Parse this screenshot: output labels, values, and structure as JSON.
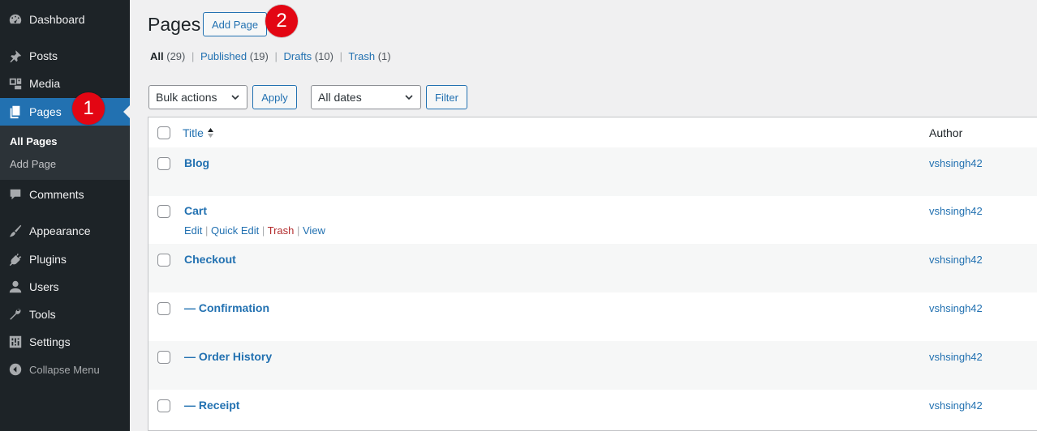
{
  "sidebar": {
    "items": [
      {
        "label": "Dashboard",
        "icon": "dashboard-icon"
      },
      {
        "label": "Posts",
        "icon": "pin-icon"
      },
      {
        "label": "Media",
        "icon": "media-icon"
      },
      {
        "label": "Pages",
        "icon": "pages-icon"
      },
      {
        "label": "Comments",
        "icon": "comment-icon"
      },
      {
        "label": "Appearance",
        "icon": "brush-icon"
      },
      {
        "label": "Plugins",
        "icon": "plugin-icon"
      },
      {
        "label": "Users",
        "icon": "user-icon"
      },
      {
        "label": "Tools",
        "icon": "wrench-icon"
      },
      {
        "label": "Settings",
        "icon": "settings-icon"
      },
      {
        "label": "Collapse Menu",
        "icon": "collapse-icon"
      }
    ],
    "submenu": [
      "All Pages",
      "Add Page"
    ]
  },
  "annotations": {
    "badge1": "1",
    "badge2": "2"
  },
  "header": {
    "title": "Pages",
    "add_button": "Add Page"
  },
  "filters": {
    "all": {
      "label": "All",
      "count": "(29)"
    },
    "published": {
      "label": "Published",
      "count": "(19)"
    },
    "drafts": {
      "label": "Drafts",
      "count": "(10)"
    },
    "trash": {
      "label": "Trash",
      "count": "(1)"
    }
  },
  "toolbar": {
    "bulk_actions": "Bulk actions",
    "apply": "Apply",
    "dates": "All dates",
    "filter": "Filter"
  },
  "table": {
    "columns": {
      "title": "Title",
      "author": "Author"
    },
    "rows": [
      {
        "title": "Blog",
        "author": "vshsingh42"
      },
      {
        "title": "Cart",
        "author": "vshsingh42"
      },
      {
        "title": "Checkout",
        "author": "vshsingh42"
      },
      {
        "title": "— Confirmation",
        "author": "vshsingh42"
      },
      {
        "title": "— Order History",
        "author": "vshsingh42"
      },
      {
        "title": "— Receipt",
        "author": "vshsingh42"
      }
    ],
    "row_actions": {
      "edit": "Edit",
      "quick_edit": "Quick Edit",
      "trash": "Trash",
      "view": "View"
    }
  },
  "colors": {
    "accent": "#2271b1",
    "sidebar": "#1d2327",
    "badge": "#e30613",
    "trash": "#b32d2e"
  }
}
